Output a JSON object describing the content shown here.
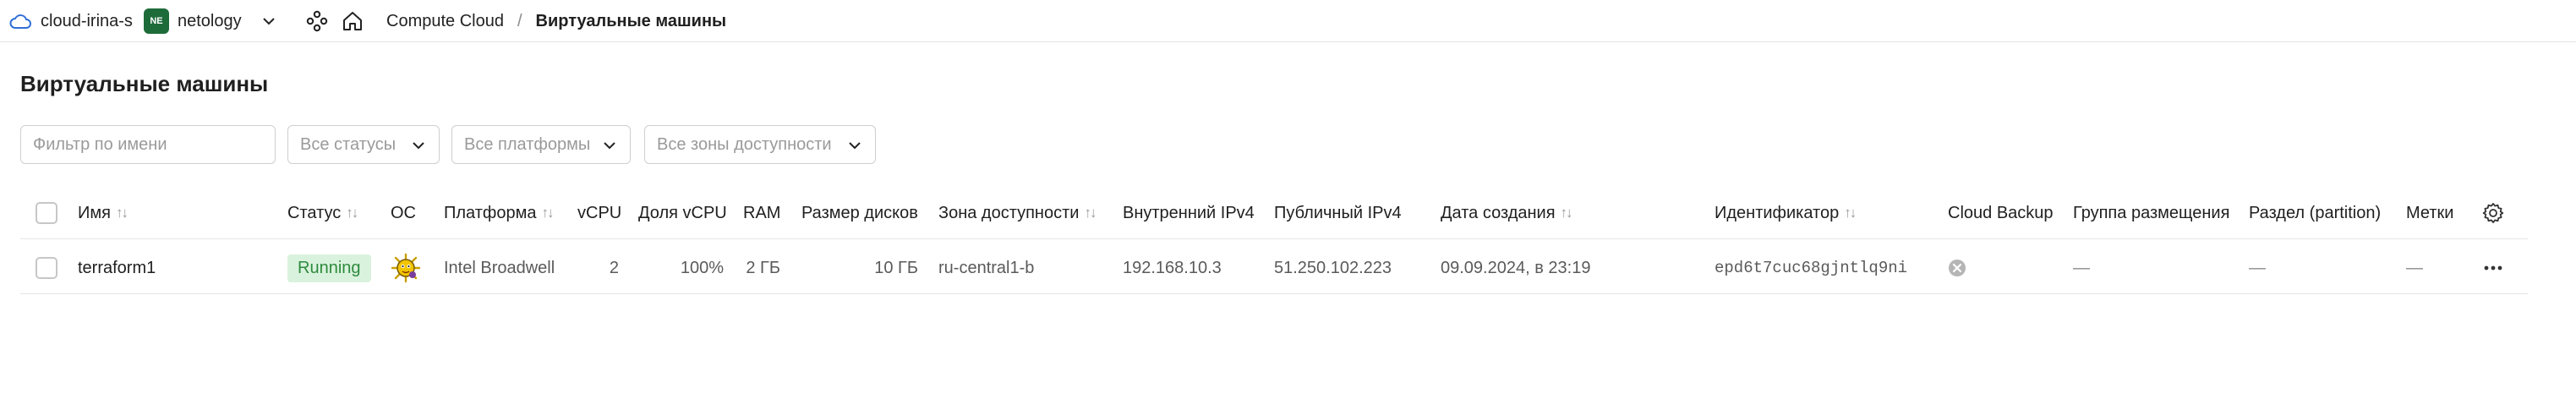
{
  "header": {
    "cloud_name": "cloud-irina-s",
    "org_badge": "NE",
    "org_name": "netology",
    "breadcrumb": {
      "service": "Compute Cloud",
      "separator": "/",
      "current": "Виртуальные машины"
    }
  },
  "page": {
    "title": "Виртуальные машины"
  },
  "filters": {
    "name_placeholder": "Фильтр по имени",
    "status": "Все статусы",
    "platform": "Все платформы",
    "zone": "Все зоны доступности"
  },
  "table": {
    "columns": {
      "name": "Имя",
      "status": "Статус",
      "os": "ОС",
      "platform": "Платформа",
      "vcpu": "vCPU",
      "vcpu_share": "Доля vCPU",
      "ram": "RAM",
      "disk_size": "Размер дисков",
      "zone": "Зона доступности",
      "internal_ip": "Внутренний IPv4",
      "public_ip": "Публичный IPv4",
      "created": "Дата создания",
      "id": "Идентификатор",
      "backup": "Cloud Backup",
      "placement": "Группа размещения",
      "partition": "Раздел (partition)",
      "labels": "Метки"
    },
    "rows": [
      {
        "name": "terraform1",
        "status": "Running",
        "os_icon": "openbsd-os-icon",
        "platform": "Intel Broadwell",
        "vcpu": "2",
        "vcpu_share": "100%",
        "ram": "2 ГБ",
        "disk_size": "10 ГБ",
        "zone": "ru-central1-b",
        "internal_ip": "192.168.10.3",
        "public_ip": "51.250.102.223",
        "created": "09.09.2024, в 23:19",
        "id": "epd6t7cuc68gjntlq9ni",
        "backup_icon": "backup-disabled-icon",
        "placement": "—",
        "partition": "—",
        "labels": "—"
      }
    ]
  },
  "colors": {
    "status_running_bg": "#d9f2dd",
    "status_running_text": "#2f8a3e",
    "org_badge_bg": "#1e6b3a"
  }
}
